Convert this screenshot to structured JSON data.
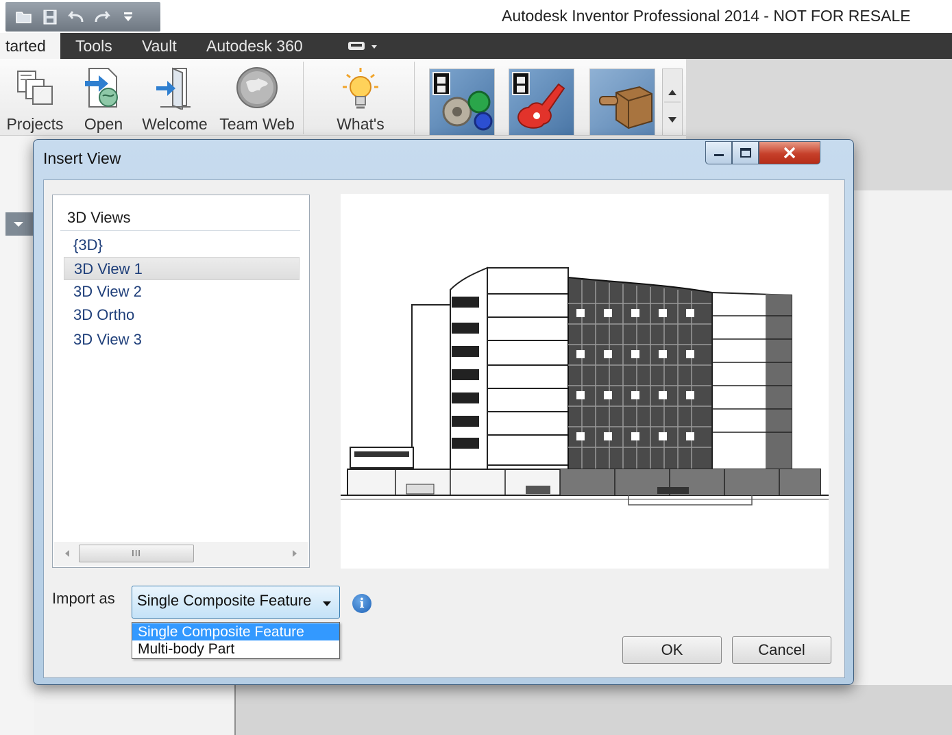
{
  "app": {
    "title": "Autodesk Inventor Professional 2014 - NOT FOR RESALE",
    "quick_access_icons": [
      "open-folder-icon",
      "save-icon",
      "undo-icon",
      "redo-icon",
      "customize-dropdown-icon"
    ]
  },
  "ribbon": {
    "tabs": [
      {
        "label": "tarted",
        "active": true
      },
      {
        "label": "Tools"
      },
      {
        "label": "Vault"
      },
      {
        "label": "Autodesk 360"
      }
    ],
    "buttons": [
      {
        "label": "Projects",
        "icon": "projects-icon"
      },
      {
        "label": "Open",
        "icon": "open-icon"
      },
      {
        "label": "Welcome",
        "icon": "welcome-icon"
      },
      {
        "label": "Team Web",
        "icon": "globe-icon"
      },
      {
        "label": "What's",
        "icon": "lightbulb-icon"
      }
    ],
    "gallery_icons": [
      "gear-assembly-thumbnail",
      "guitar-thumbnail",
      "part-thumbnail"
    ]
  },
  "dialog": {
    "title": "Insert View",
    "tree": {
      "group": "3D Views",
      "items": [
        "{3D}",
        "3D View 1",
        "3D View 2",
        "3D Ortho",
        "3D View 3"
      ],
      "selected": "3D View 1",
      "scroll_thumb": "III"
    },
    "preview_icon": "building-3d-preview",
    "import": {
      "label": "Import as",
      "value": "Single Composite Feature",
      "options": [
        "Single Composite Feature",
        "Multi-body Part"
      ],
      "highlighted": "Single Composite Feature",
      "info_icon": "i"
    },
    "ok_label": "OK",
    "cancel_label": "Cancel"
  },
  "colors": {
    "dialog_frame": "#b4cde4",
    "selection_highlight": "#3399ff",
    "close_button": "#c6402a",
    "ribbon_tab_bar": "#383838"
  }
}
